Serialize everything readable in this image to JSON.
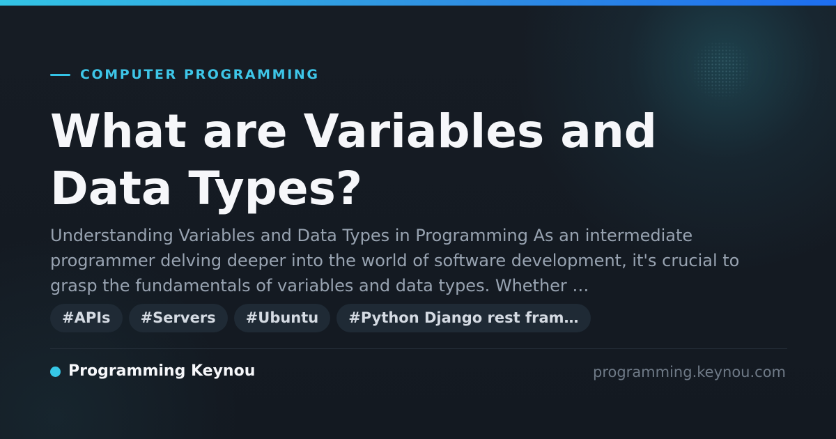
{
  "theme": {
    "accent": "#36c7e6",
    "accent_gradient_end": "#1d6ef0",
    "background": "#141a22",
    "title_color": "#f6f7fa",
    "muted_text": "#98a3b1",
    "tag_background": "#1f2a35"
  },
  "category": {
    "label": "COMPUTER PROGRAMMING"
  },
  "article": {
    "title": "What are Variables and Data Types?",
    "excerpt": "Understanding Variables and Data Types in Programming As an intermediate programmer delving deeper into the world of software development, it's crucial to grasp the fundamentals of variables and data types. Whether …"
  },
  "tags": [
    "#APIs",
    "#Servers",
    "#Ubuntu",
    "#Python Django rest fram…"
  ],
  "footer": {
    "brand_name": "Programming Keynou",
    "domain": "programming.keynou.com"
  },
  "icons": {
    "category_marker": "dash-icon",
    "brand_marker": "dot-icon"
  }
}
